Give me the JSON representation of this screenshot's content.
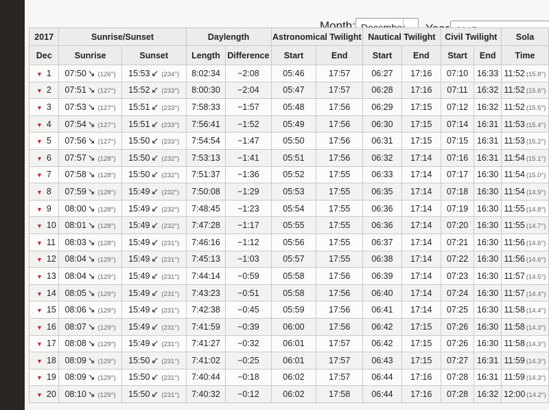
{
  "controls": {
    "month_label": "Month:",
    "month_value": "December",
    "year_label": "Year:",
    "year_value": "2017"
  },
  "table": {
    "year": "2017",
    "month_short": "Dec",
    "groups": {
      "sunrise_sunset": "Sunrise/Sunset",
      "daylength": "Daylength",
      "astro": "Astronomical Twilight",
      "nautical": "Nautical Twilight",
      "civil": "Civil Twilight",
      "solar": "Sola"
    },
    "subheads": {
      "sunrise": "Sunrise",
      "sunset": "Sunset",
      "length": "Length",
      "difference": "Difference",
      "start": "Start",
      "end": "End",
      "time": "Time"
    },
    "rows": [
      {
        "day": "1",
        "rise": "07:50",
        "rise_az": "(126°)",
        "set": "15:53",
        "set_az": "(234°)",
        "len": "8:02:34",
        "diff": "−2:08",
        "as": "05:46",
        "ae": "17:57",
        "ns": "06:27",
        "ne": "17:16",
        "cs": "07:10",
        "ce": "16:33",
        "noon": "11:52",
        "alt": "(15.8°)"
      },
      {
        "day": "2",
        "rise": "07:51",
        "rise_az": "(127°)",
        "set": "15:52",
        "set_az": "(233°)",
        "len": "8:00:30",
        "diff": "−2:04",
        "as": "05:47",
        "ae": "17:57",
        "ns": "06:28",
        "ne": "17:16",
        "cs": "07:11",
        "ce": "16:32",
        "noon": "11:52",
        "alt": "(15.6°)"
      },
      {
        "day": "3",
        "rise": "07:53",
        "rise_az": "(127°)",
        "set": "15:51",
        "set_az": "(233°)",
        "len": "7:58:33",
        "diff": "−1:57",
        "as": "05:48",
        "ae": "17:56",
        "ns": "06:29",
        "ne": "17:15",
        "cs": "07:12",
        "ce": "16:32",
        "noon": "11:52",
        "alt": "(15.5°)"
      },
      {
        "day": "4",
        "rise": "07:54",
        "rise_az": "(127°)",
        "set": "15:51",
        "set_az": "(233°)",
        "len": "7:56:41",
        "diff": "−1:52",
        "as": "05:49",
        "ae": "17:56",
        "ns": "06:30",
        "ne": "17:15",
        "cs": "07:14",
        "ce": "16:31",
        "noon": "11:53",
        "alt": "(15.4°)"
      },
      {
        "day": "5",
        "rise": "07:56",
        "rise_az": "(127°)",
        "set": "15:50",
        "set_az": "(233°)",
        "len": "7:54:54",
        "diff": "−1:47",
        "as": "05:50",
        "ae": "17:56",
        "ns": "06:31",
        "ne": "17:15",
        "cs": "07:15",
        "ce": "16:31",
        "noon": "11:53",
        "alt": "(15.2°)"
      },
      {
        "day": "6",
        "rise": "07:57",
        "rise_az": "(128°)",
        "set": "15:50",
        "set_az": "(232°)",
        "len": "7:53:13",
        "diff": "−1:41",
        "as": "05:51",
        "ae": "17:56",
        "ns": "06:32",
        "ne": "17:14",
        "cs": "07:16",
        "ce": "16:31",
        "noon": "11:54",
        "alt": "(15.1°)"
      },
      {
        "day": "7",
        "rise": "07:58",
        "rise_az": "(128°)",
        "set": "15:50",
        "set_az": "(232°)",
        "len": "7:51:37",
        "diff": "−1:36",
        "as": "05:52",
        "ae": "17:55",
        "ns": "06:33",
        "ne": "17:14",
        "cs": "07:17",
        "ce": "16:30",
        "noon": "11:54",
        "alt": "(15.0°)"
      },
      {
        "day": "8",
        "rise": "07:59",
        "rise_az": "(128°)",
        "set": "15:49",
        "set_az": "(232°)",
        "len": "7:50:08",
        "diff": "−1:29",
        "as": "05:53",
        "ae": "17:55",
        "ns": "06:35",
        "ne": "17:14",
        "cs": "07:18",
        "ce": "16:30",
        "noon": "11:54",
        "alt": "(14.9°)"
      },
      {
        "day": "9",
        "rise": "08:00",
        "rise_az": "(128°)",
        "set": "15:49",
        "set_az": "(232°)",
        "len": "7:48:45",
        "diff": "−1:23",
        "as": "05:54",
        "ae": "17:55",
        "ns": "06:36",
        "ne": "17:14",
        "cs": "07:19",
        "ce": "16:30",
        "noon": "11:55",
        "alt": "(14.8°)"
      },
      {
        "day": "10",
        "rise": "08:01",
        "rise_az": "(128°)",
        "set": "15:49",
        "set_az": "(232°)",
        "len": "7:47:28",
        "diff": "−1:17",
        "as": "05:55",
        "ae": "17:55",
        "ns": "06:36",
        "ne": "17:14",
        "cs": "07:20",
        "ce": "16:30",
        "noon": "11:55",
        "alt": "(14.7°)"
      },
      {
        "day": "11",
        "rise": "08:03",
        "rise_az": "(128°)",
        "set": "15:49",
        "set_az": "(231°)",
        "len": "7:46:16",
        "diff": "−1:12",
        "as": "05:56",
        "ae": "17:55",
        "ns": "06:37",
        "ne": "17:14",
        "cs": "07:21",
        "ce": "16:30",
        "noon": "11:56",
        "alt": "(14.6°)"
      },
      {
        "day": "12",
        "rise": "08:04",
        "rise_az": "(129°)",
        "set": "15:49",
        "set_az": "(231°)",
        "len": "7:45:13",
        "diff": "−1:03",
        "as": "05:57",
        "ae": "17:55",
        "ns": "06:38",
        "ne": "17:14",
        "cs": "07:22",
        "ce": "16:30",
        "noon": "11:56",
        "alt": "(14.6°)"
      },
      {
        "day": "13",
        "rise": "08:04",
        "rise_az": "(129°)",
        "set": "15:49",
        "set_az": "(231°)",
        "len": "7:44:14",
        "diff": "−0:59",
        "as": "05:58",
        "ae": "17:56",
        "ns": "06:39",
        "ne": "17:14",
        "cs": "07:23",
        "ce": "16:30",
        "noon": "11:57",
        "alt": "(14.5°)"
      },
      {
        "day": "14",
        "rise": "08:05",
        "rise_az": "(129°)",
        "set": "15:49",
        "set_az": "(231°)",
        "len": "7:43:23",
        "diff": "−0:51",
        "as": "05:58",
        "ae": "17:56",
        "ns": "06:40",
        "ne": "17:14",
        "cs": "07:24",
        "ce": "16:30",
        "noon": "11:57",
        "alt": "(14.4°)"
      },
      {
        "day": "15",
        "rise": "08:06",
        "rise_az": "(129°)",
        "set": "15:49",
        "set_az": "(231°)",
        "len": "7:42:38",
        "diff": "−0:45",
        "as": "05:59",
        "ae": "17:56",
        "ns": "06:41",
        "ne": "17:14",
        "cs": "07:25",
        "ce": "16:30",
        "noon": "11:58",
        "alt": "(14.4°)"
      },
      {
        "day": "16",
        "rise": "08:07",
        "rise_az": "(129°)",
        "set": "15:49",
        "set_az": "(231°)",
        "len": "7:41:59",
        "diff": "−0:39",
        "as": "06:00",
        "ae": "17:56",
        "ns": "06:42",
        "ne": "17:15",
        "cs": "07:26",
        "ce": "16:30",
        "noon": "11:58",
        "alt": "(14.3°)"
      },
      {
        "day": "17",
        "rise": "08:08",
        "rise_az": "(129°)",
        "set": "15:49",
        "set_az": "(231°)",
        "len": "7:41:27",
        "diff": "−0:32",
        "as": "06:01",
        "ae": "17:57",
        "ns": "06:42",
        "ne": "17:15",
        "cs": "07:26",
        "ce": "16:30",
        "noon": "11:58",
        "alt": "(14.3°)"
      },
      {
        "day": "18",
        "rise": "08:09",
        "rise_az": "(129°)",
        "set": "15:50",
        "set_az": "(231°)",
        "len": "7:41:02",
        "diff": "−0:25",
        "as": "06:01",
        "ae": "17:57",
        "ns": "06:43",
        "ne": "17:15",
        "cs": "07:27",
        "ce": "16:31",
        "noon": "11:59",
        "alt": "(14.3°)"
      },
      {
        "day": "19",
        "rise": "08:09",
        "rise_az": "(129°)",
        "set": "15:50",
        "set_az": "(231°)",
        "len": "7:40:44",
        "diff": "−0:18",
        "as": "06:02",
        "ae": "17:57",
        "ns": "06:44",
        "ne": "17:16",
        "cs": "07:28",
        "ce": "16:31",
        "noon": "11:59",
        "alt": "(14.3°)"
      },
      {
        "day": "20",
        "rise": "08:10",
        "rise_az": "(129°)",
        "set": "15:50",
        "set_az": "(231°)",
        "len": "7:40:32",
        "diff": "−0:12",
        "as": "06:02",
        "ae": "17:58",
        "ns": "06:44",
        "ne": "17:16",
        "cs": "07:28",
        "ce": "16:32",
        "noon": "12:00",
        "alt": "(14.2°)"
      }
    ]
  },
  "colors": {
    "accent_triangle": "#c0262b"
  }
}
